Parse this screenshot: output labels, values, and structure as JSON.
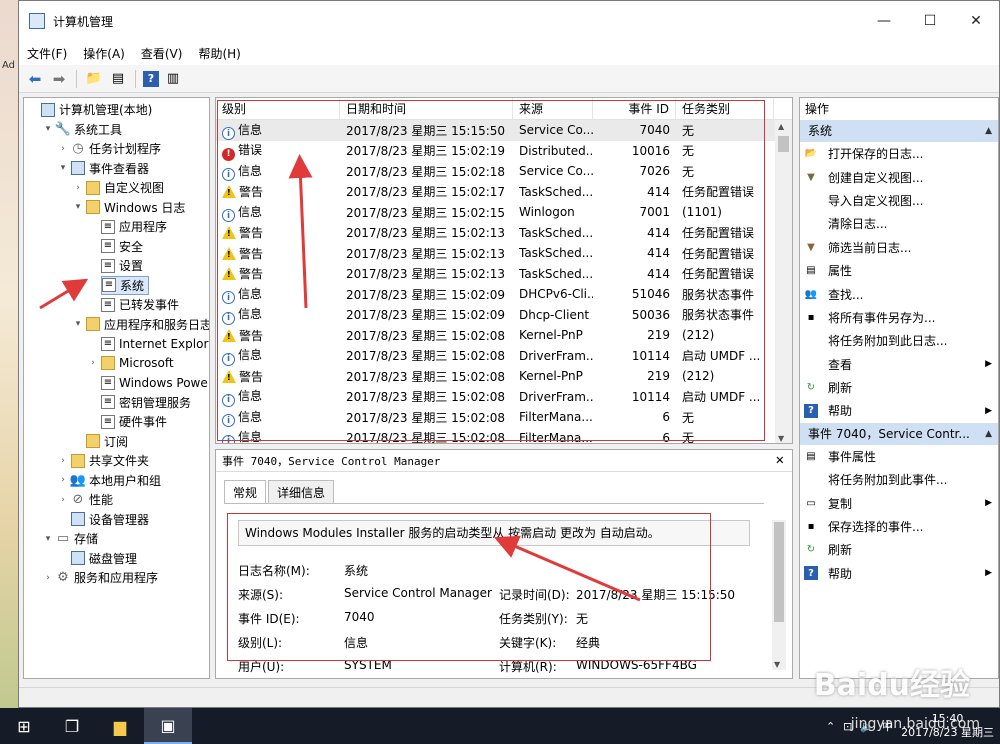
{
  "window": {
    "title": "计算机管理"
  },
  "menu": [
    "文件(F)",
    "操作(A)",
    "查看(V)",
    "帮助(H)"
  ],
  "tree": [
    {
      "label": "计算机管理(本地)",
      "level": 0,
      "icon": "computer-icon",
      "tw": ""
    },
    {
      "label": "系统工具",
      "level": 1,
      "icon": "tools-icon",
      "tw": "▾"
    },
    {
      "label": "任务计划程序",
      "level": 2,
      "icon": "clock-icon",
      "tw": "›"
    },
    {
      "label": "事件查看器",
      "level": 2,
      "icon": "event-viewer-icon",
      "tw": "▾"
    },
    {
      "label": "自定义视图",
      "level": 3,
      "icon": "folder-icon",
      "tw": "›"
    },
    {
      "label": "Windows 日志",
      "level": 3,
      "icon": "folder-icon",
      "tw": "▾"
    },
    {
      "label": "应用程序",
      "level": 4,
      "icon": "log-icon",
      "tw": ""
    },
    {
      "label": "安全",
      "level": 4,
      "icon": "log-icon",
      "tw": ""
    },
    {
      "label": "设置",
      "level": 4,
      "icon": "log-icon",
      "tw": ""
    },
    {
      "label": "系统",
      "level": 4,
      "icon": "log-icon",
      "tw": "",
      "selected": true
    },
    {
      "label": "已转发事件",
      "level": 4,
      "icon": "log-icon",
      "tw": ""
    },
    {
      "label": "应用程序和服务日志",
      "level": 3,
      "icon": "folder-icon",
      "tw": "▾"
    },
    {
      "label": "Internet Explor",
      "level": 4,
      "icon": "log-icon",
      "tw": ""
    },
    {
      "label": "Microsoft",
      "level": 4,
      "icon": "folder-icon",
      "tw": "›"
    },
    {
      "label": "Windows Powe",
      "level": 4,
      "icon": "log-icon",
      "tw": ""
    },
    {
      "label": "密钥管理服务",
      "level": 4,
      "icon": "log-icon",
      "tw": ""
    },
    {
      "label": "硬件事件",
      "level": 4,
      "icon": "log-icon",
      "tw": ""
    },
    {
      "label": "订阅",
      "level": 3,
      "icon": "subscription-icon",
      "tw": ""
    },
    {
      "label": "共享文件夹",
      "level": 2,
      "icon": "shared-folder-icon",
      "tw": "›"
    },
    {
      "label": "本地用户和组",
      "level": 2,
      "icon": "users-icon",
      "tw": "›"
    },
    {
      "label": "性能",
      "level": 2,
      "icon": "performance-icon",
      "tw": "›"
    },
    {
      "label": "设备管理器",
      "level": 2,
      "icon": "device-manager-icon",
      "tw": ""
    },
    {
      "label": "存储",
      "level": 1,
      "icon": "storage-icon",
      "tw": "▾"
    },
    {
      "label": "磁盘管理",
      "level": 2,
      "icon": "disk-icon",
      "tw": ""
    },
    {
      "label": "服务和应用程序",
      "level": 1,
      "icon": "services-icon",
      "tw": "›"
    }
  ],
  "events": {
    "headers": [
      "级别",
      "日期和时间",
      "来源",
      "事件 ID",
      "任务类别"
    ],
    "rows": [
      {
        "level": "信息",
        "type": "info",
        "time": "2017/8/23 星期三 15:15:50",
        "source": "Service Co...",
        "id": "7040",
        "task": "无"
      },
      {
        "level": "错误",
        "type": "err",
        "time": "2017/8/23 星期三 15:02:19",
        "source": "Distributed...",
        "id": "10016",
        "task": "无"
      },
      {
        "level": "信息",
        "type": "info",
        "time": "2017/8/23 星期三 15:02:18",
        "source": "Service Co...",
        "id": "7026",
        "task": "无"
      },
      {
        "level": "警告",
        "type": "warn",
        "time": "2017/8/23 星期三 15:02:17",
        "source": "TaskSched...",
        "id": "414",
        "task": "任务配置错误"
      },
      {
        "level": "信息",
        "type": "info",
        "time": "2017/8/23 星期三 15:02:15",
        "source": "Winlogon",
        "id": "7001",
        "task": "(1101)"
      },
      {
        "level": "警告",
        "type": "warn",
        "time": "2017/8/23 星期三 15:02:13",
        "source": "TaskSched...",
        "id": "414",
        "task": "任务配置错误"
      },
      {
        "level": "警告",
        "type": "warn",
        "time": "2017/8/23 星期三 15:02:13",
        "source": "TaskSched...",
        "id": "414",
        "task": "任务配置错误"
      },
      {
        "level": "警告",
        "type": "warn",
        "time": "2017/8/23 星期三 15:02:13",
        "source": "TaskSched...",
        "id": "414",
        "task": "任务配置错误"
      },
      {
        "level": "信息",
        "type": "info",
        "time": "2017/8/23 星期三 15:02:09",
        "source": "DHCPv6-Cli...",
        "id": "51046",
        "task": "服务状态事件"
      },
      {
        "level": "信息",
        "type": "info",
        "time": "2017/8/23 星期三 15:02:09",
        "source": "Dhcp-Client",
        "id": "50036",
        "task": "服务状态事件"
      },
      {
        "level": "警告",
        "type": "warn",
        "time": "2017/8/23 星期三 15:02:08",
        "source": "Kernel-PnP",
        "id": "219",
        "task": "(212)"
      },
      {
        "level": "信息",
        "type": "info",
        "time": "2017/8/23 星期三 15:02:08",
        "source": "DriverFram...",
        "id": "10114",
        "task": "启动 UMDF ..."
      },
      {
        "level": "警告",
        "type": "warn",
        "time": "2017/8/23 星期三 15:02:08",
        "source": "Kernel-PnP",
        "id": "219",
        "task": "(212)"
      },
      {
        "level": "信息",
        "type": "info",
        "time": "2017/8/23 星期三 15:02:08",
        "source": "DriverFram...",
        "id": "10114",
        "task": "启动 UMDF ..."
      },
      {
        "level": "信息",
        "type": "info",
        "time": "2017/8/23 星期三 15:02:08",
        "source": "FilterMana...",
        "id": "6",
        "task": "无"
      },
      {
        "level": "信息",
        "type": "info",
        "time": "2017/8/23 星期三 15:02:08",
        "source": "FilterMana...",
        "id": "6",
        "task": "无"
      }
    ]
  },
  "detail": {
    "title": "事件 7040，Service Control Manager",
    "tabs": [
      "常规",
      "详细信息"
    ],
    "description": "Windows Modules Installer 服务的启动类型从 按需启动 更改为 自动启动。",
    "fields": {
      "log_name_label": "日志名称(M):",
      "log_name": "系统",
      "source_label": "来源(S):",
      "source": "Service Control Manager",
      "logged_label": "记录时间(D):",
      "logged": "2017/8/23 星期三 15:15:50",
      "event_id_label": "事件 ID(E):",
      "event_id": "7040",
      "task_label": "任务类别(Y):",
      "task": "无",
      "level_label": "级别(L):",
      "level": "信息",
      "keywords_label": "关键字(K):",
      "keywords": "经典",
      "user_label": "用户(U):",
      "user": "SYSTEM",
      "computer_label": "计算机(R):",
      "computer": "WINDOWS-65FF4BG"
    }
  },
  "actions": {
    "header": "操作",
    "section1": "系统",
    "items1": [
      {
        "label": "打开保存的日志...",
        "icon": "open-log-icon"
      },
      {
        "label": "创建自定义视图...",
        "icon": "filter-icon"
      },
      {
        "label": "导入自定义视图...",
        "icon": "import-icon"
      },
      {
        "label": "清除日志...",
        "icon": "clear-icon"
      },
      {
        "label": "筛选当前日志...",
        "icon": "filter-icon"
      },
      {
        "label": "属性",
        "icon": "properties-icon"
      },
      {
        "label": "查找...",
        "icon": "find-icon"
      },
      {
        "label": "将所有事件另存为...",
        "icon": "save-icon"
      },
      {
        "label": "将任务附加到此日志...",
        "icon": "task-icon"
      },
      {
        "label": "查看",
        "icon": "view-icon",
        "more": true
      },
      {
        "label": "刷新",
        "icon": "refresh-icon"
      },
      {
        "label": "帮助",
        "icon": "help-icon",
        "more": true
      }
    ],
    "section2": "事件 7040，Service Contr...",
    "items2": [
      {
        "label": "事件属性",
        "icon": "event-properties-icon"
      },
      {
        "label": "将任务附加到此事件...",
        "icon": "task-icon"
      },
      {
        "label": "复制",
        "icon": "copy-icon",
        "more": true
      },
      {
        "label": "保存选择的事件...",
        "icon": "save-icon"
      },
      {
        "label": "刷新",
        "icon": "refresh-icon"
      },
      {
        "label": "帮助",
        "icon": "help-icon",
        "more": true
      }
    ]
  },
  "taskbar": {
    "time": "15:40",
    "date": "2017/8/23 星期三",
    "ime": "中"
  },
  "watermark": {
    "brand": "Baidu经验",
    "url": "jingyan.baidu.com"
  },
  "desktop": {
    "left_label": "Ad"
  }
}
